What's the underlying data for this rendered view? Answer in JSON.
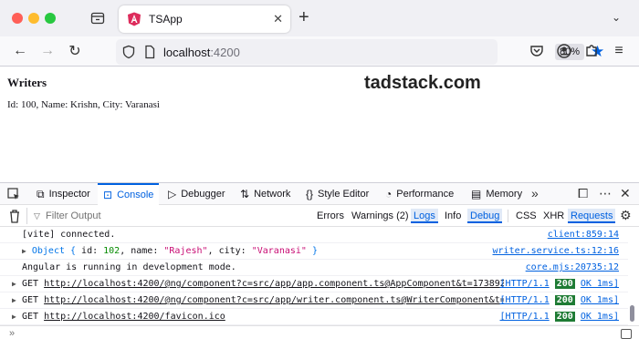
{
  "browser": {
    "tab_title": "TSApp",
    "url_host": "localhost",
    "url_port": ":4200",
    "zoom": "80%",
    "icons": [
      "tab-list-icon",
      "angular-favicon",
      "close-icon",
      "new-tab-icon",
      "back-icon",
      "forward-icon",
      "reload-icon",
      "shield-icon",
      "page-icon",
      "star-icon",
      "pocket-icon",
      "account-icon",
      "extensions-icon",
      "menu-icon"
    ]
  },
  "page": {
    "heading": "Writers",
    "brand": "tadstack.com",
    "line": "Id: 100, Name: Krishn, City: Varanasi"
  },
  "devtools": {
    "tabs": [
      "Inspector",
      "Console",
      "Debugger",
      "Network",
      "Style Editor",
      "Performance",
      "Memory"
    ],
    "active_tab": "Console",
    "filter_placeholder": "Filter Output",
    "levels": [
      "Errors",
      "Warnings (2)",
      "Logs",
      "Info",
      "Debug"
    ],
    "extras": [
      "CSS",
      "XHR",
      "Requests"
    ],
    "messages": [
      {
        "text": "[vite] connected.",
        "source": "client:859:14"
      },
      {
        "prefix": "Object { ",
        "k1": "id: ",
        "v1": "102",
        "k2": ", name: ",
        "v2": "\"Rajesh\"",
        "k3": ", city: ",
        "v3": "\"Varanasi\"",
        "suffix": " }",
        "source": "writer.service.ts:12:16"
      },
      {
        "text": "Angular is running in development mode.",
        "source": "core.mjs:20735:12"
      }
    ],
    "requests": [
      {
        "method": "GET",
        "url": "http://localhost:4200/@ng/component?c=src/app/app.component.ts@AppComponent&t=17389222422…",
        "proto": "[HTTP/1.1",
        "status": "200",
        "text": "OK 1ms]"
      },
      {
        "method": "GET",
        "url": "http://localhost:4200/@ng/component?c=src/app/writer.component.ts@WriterComponent&t=17389…",
        "proto": "[HTTP/1.1",
        "status": "200",
        "text": "OK 1ms]"
      },
      {
        "method": "GET",
        "url": "http://localhost:4200/favicon.ico",
        "proto": "[HTTP/1.1",
        "status": "200",
        "text": "OK 1ms]"
      }
    ],
    "prompt": "»"
  }
}
